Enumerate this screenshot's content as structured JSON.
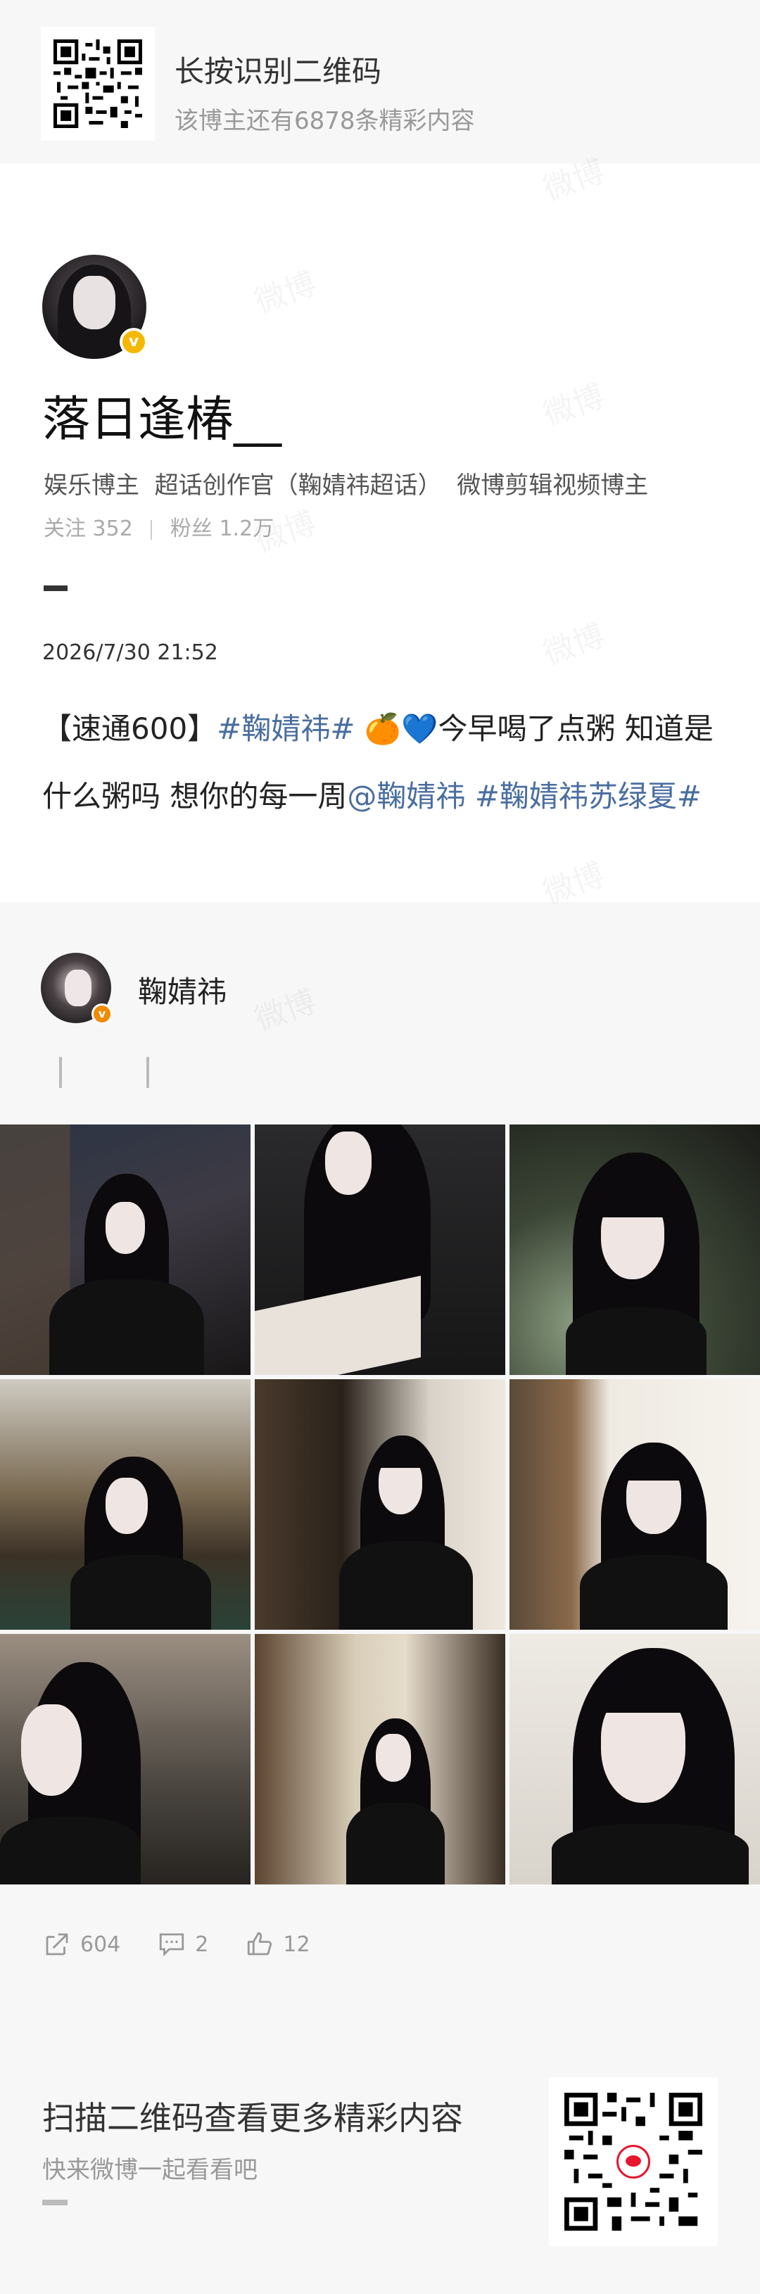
{
  "top_banner": {
    "title": "长按识别二维码",
    "subtitle": "该博主还有6878条精彩内容"
  },
  "author": {
    "name": "落日逢椿__",
    "verified_badge": "v",
    "tags": "娱乐博主  超话创作官（鞠婧祎超话）  微博剪辑视频博主",
    "follow_label": "关注",
    "follow_count": "352",
    "fans_label": "粉丝",
    "fans_count": "1.2万"
  },
  "post": {
    "time": "2026/7/30  21:52",
    "text_prefix": "【速通600】",
    "tag1": "#鞠婧祎#",
    "emoji": " 🍊💙",
    "text_mid": "今早喝了点粥  知道是什么粥吗  想你的每一周",
    "mention": "@鞠婧祎",
    "tag2": "  #鞠婧祎苏绿夏#"
  },
  "repost": {
    "user_name": "鞠婧祎",
    "badge": "v",
    "images": [
      "photo-dark-armchair",
      "photo-piano-hand",
      "photo-selfie-green-chair",
      "photo-library-desk",
      "photo-bookshelf-piano",
      "photo-doorway-portrait",
      "photo-side-profile",
      "photo-arched-hall",
      "photo-closeup-hairclip"
    ]
  },
  "actions": {
    "repost_count": "604",
    "comment_count": "2",
    "like_count": "12"
  },
  "footer": {
    "title": "扫描二维码查看更多精彩内容",
    "subtitle": "快来微博一起看看吧"
  },
  "watermark": "微博",
  "colors": {
    "link": "#4a6ea0",
    "badge_gold": "#f5b800",
    "badge_orange": "#f08a00",
    "weibo_red": "#e6162d"
  }
}
